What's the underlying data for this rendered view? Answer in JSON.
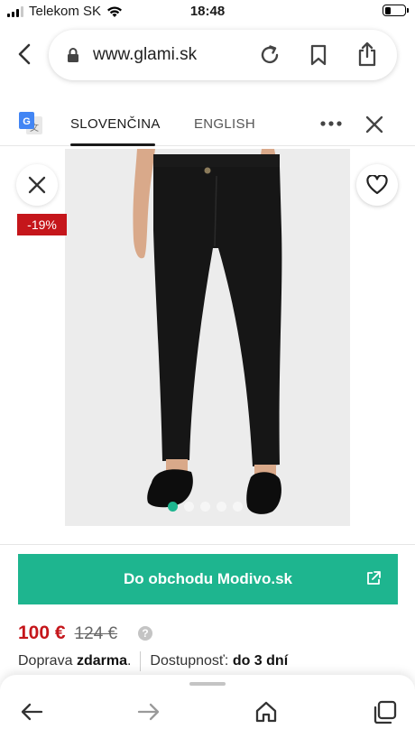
{
  "status_bar": {
    "carrier": "Telekom SK",
    "time": "18:48",
    "battery_level": 0.3
  },
  "browser": {
    "url": "www.glami.sk",
    "icons": [
      "back-icon",
      "lock-icon",
      "reload-icon",
      "bookmark-icon",
      "share-icon"
    ]
  },
  "translate_bar": {
    "active_language": "SLOVENČINA",
    "other_language": "ENGLISH",
    "icons": [
      "google-translate-icon",
      "more-icon",
      "close-icon"
    ]
  },
  "product": {
    "discount": "-19%",
    "image_count": 5,
    "active_image_index": 0,
    "icons": [
      "close-icon",
      "heart-icon",
      "chevron-left-icon",
      "chevron-right-icon"
    ]
  },
  "cta": {
    "label": "Do obchodu Modivo.sk",
    "icon": "external-link-icon"
  },
  "price": {
    "current": "100 €",
    "original": "124 €",
    "info_icon": "?"
  },
  "shipping": {
    "label": "Doprava",
    "value": "zdarma",
    "period": ".",
    "availability_label": "Dostupnosť:",
    "availability_value": "do 3 dní"
  },
  "bottom_toolbar": {
    "icons": [
      "back-arrow-icon",
      "forward-arrow-icon",
      "home-icon",
      "tabs-icon"
    ]
  },
  "colors": {
    "accent": "#1eb58f",
    "price_red": "#c5161b",
    "badge_red": "#c5161b"
  }
}
